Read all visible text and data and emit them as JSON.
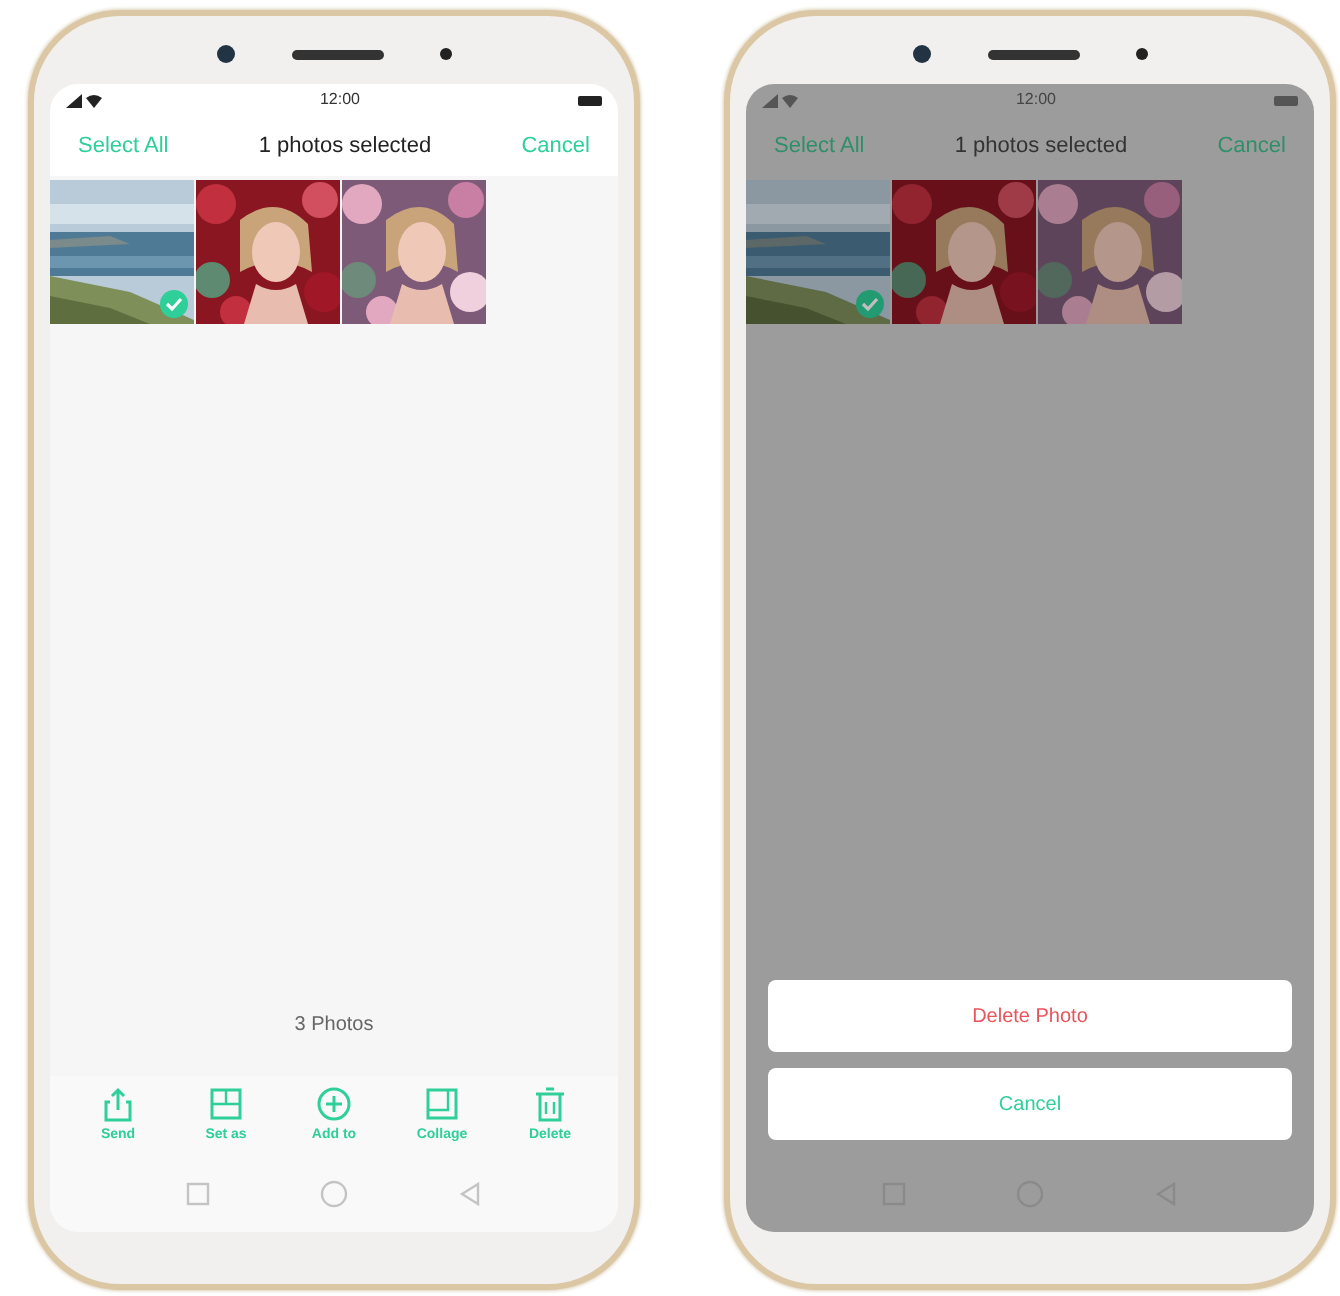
{
  "phones": [
    {
      "dimmed": false,
      "status_bar": {
        "time": "12:00"
      },
      "header": {
        "select_all": "Select All",
        "title": "1 photos selected",
        "cancel": "Cancel"
      },
      "photos": [
        {
          "selected": true
        },
        {
          "selected": false
        },
        {
          "selected": false
        }
      ],
      "count": "3 Photos",
      "toolbar": [
        {
          "label": "Send"
        },
        {
          "label": "Set as"
        },
        {
          "label": "Add to"
        },
        {
          "label": "Collage"
        },
        {
          "label": "Delete"
        }
      ]
    },
    {
      "dimmed": true,
      "status_bar": {
        "time": "12:00"
      },
      "header": {
        "select_all": "Select All",
        "title": "1 photos selected",
        "cancel": "Cancel"
      },
      "photos": [
        {
          "selected": true
        },
        {
          "selected": false
        },
        {
          "selected": false
        }
      ],
      "action_sheet": [
        {
          "label": "Delete Photo",
          "kind": "destructive"
        },
        {
          "label": "Cancel",
          "kind": "cancel"
        }
      ]
    }
  ]
}
